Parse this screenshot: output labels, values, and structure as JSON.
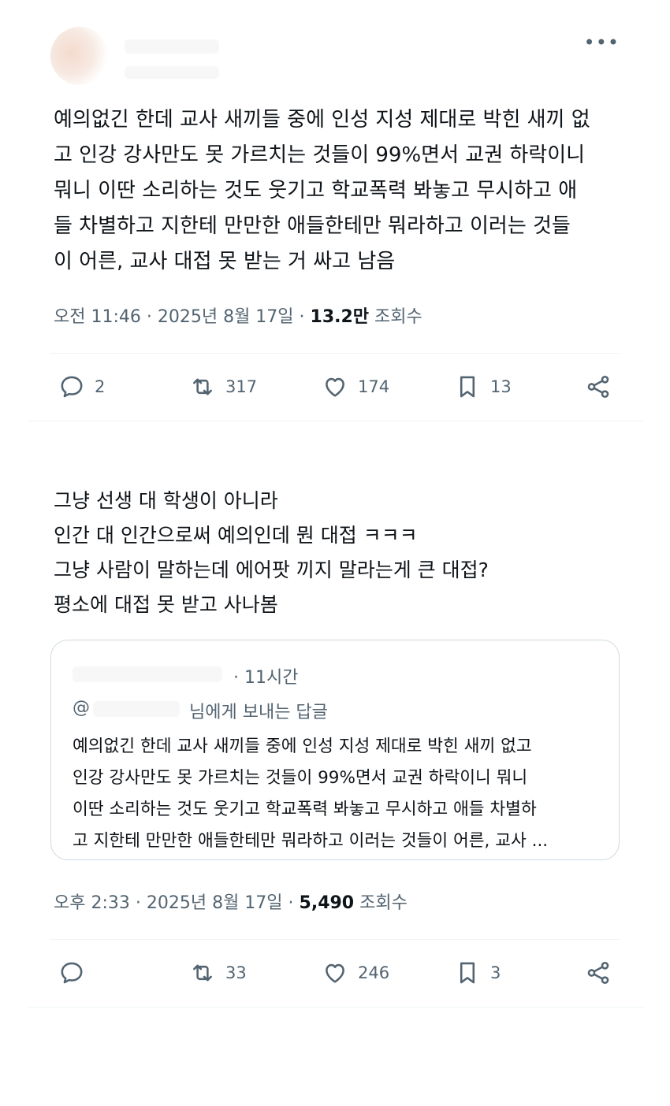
{
  "tweet1": {
    "author_name": "",
    "text_lines": [
      "예의없긴 한데 교사 새끼들 중에 인성 지성 제대로 박힌 새끼 없",
      "고 인강 강사만도 못 가르치는 것들이 99%면서 교권 하락이니",
      "뭐니 이딴 소리하는 것도 웃기고 학교폭력 봐놓고 무시하고 애",
      "들 차별하고 지한테 만만한 애들한테만 뭐라하고 이러는 것들",
      "이 어른, 교사 대접 못 받는 거 싸고 남음"
    ],
    "meta_time": "오전 11:46 · 2025년 8월 17일 · ",
    "meta_views_value": "13.2만",
    "meta_views_label": " 조회수",
    "actions": {
      "reply_count": "2",
      "retweet_count": "317",
      "like_count": "174",
      "bookmark_count": "13"
    }
  },
  "tweet2": {
    "text_lines": [
      "그냥 선생 대 학생이 아니라",
      "인간 대 인간으로써 예의인데 뭔 대접 ㅋㅋㅋ",
      "그냥 사람이 말하는데 에어팟 끼지 말라는게 큰 대접?",
      "평소에 대접 못 받고 사나봄"
    ],
    "quote": {
      "time_ago": "· 11시간",
      "reply_prefix": "@",
      "reply_suffix": "님에게 보내는 답글",
      "text_lines": [
        "예의없긴 한데 교사 새끼들 중에 인성 지성 제대로 박힌 새끼 없고",
        "인강 강사만도 못 가르치는 것들이 99%면서 교권 하락이니 뭐니",
        "이딴 소리하는 것도 웃기고 학교폭력 봐놓고 무시하고 애들 차별하",
        "고 지한테 만만한 애들한테만 뭐라하고 이러는 것들이 어른, 교사 ..."
      ]
    },
    "meta_time": "오후 2:33 · 2025년 8월 17일 · ",
    "meta_views_value": "5,490",
    "meta_views_label": " 조회수",
    "actions": {
      "reply_count": "",
      "retweet_count": "33",
      "like_count": "246",
      "bookmark_count": "3"
    }
  },
  "more_label": "•••",
  "colors": {
    "text": "#0f1419",
    "secondary": "#536471",
    "border": "#cfd9de",
    "divider": "#eff3f4"
  }
}
